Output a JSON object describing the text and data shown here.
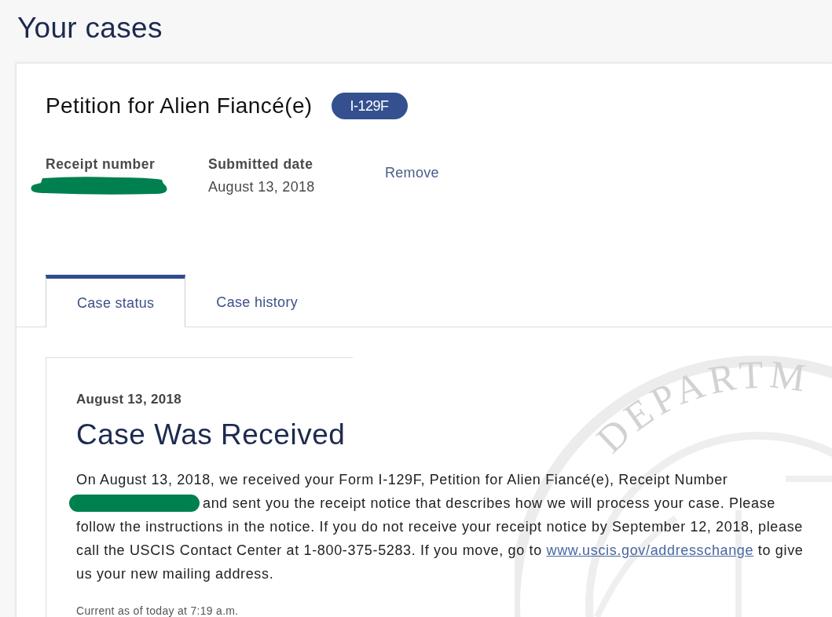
{
  "page": {
    "title": "Your cases"
  },
  "case": {
    "title": "Petition for Alien Fiancé(e)",
    "form_badge": "I-129F",
    "receipt": {
      "label": "Receipt number",
      "redacted": true
    },
    "submitted": {
      "label": "Submitted date",
      "value": "August 13, 2018"
    },
    "remove_link": "Remove",
    "tabs": [
      {
        "label": "Case status",
        "selected": true
      },
      {
        "label": "Case history",
        "selected": false
      }
    ],
    "status": {
      "date": "August 13, 2018",
      "heading": "Case Was Received",
      "message": {
        "before_redaction": "On August 13, 2018, we received your Form I-129F, Petition for Alien Fiancé(e), Receipt Number",
        "redacted": true,
        "after_redaction": "and sent you the receipt notice that describes how we will process your case. Please follow the instructions in the notice. If you do not receive your receipt notice by September 12, 2018, please call the USCIS Contact Center at 1-800-375-5283. If you move, go to",
        "link": "www.uscis.gov/addresschange",
        "after_link": "to give us your new mailing address."
      },
      "updated": "Current as of today at 7:19 a.m."
    }
  },
  "seal": {
    "text": "DEPARTM"
  }
}
